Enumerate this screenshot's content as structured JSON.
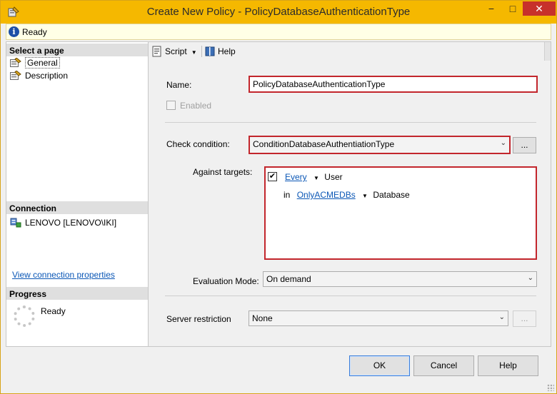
{
  "window": {
    "title": "Create New Policy - PolicyDatabaseAuthenticationType",
    "minimize_glyph": "−",
    "maximize_glyph": "□",
    "close_glyph": "✕"
  },
  "status": {
    "icon": "info-icon",
    "glyph": "i",
    "text": "Ready"
  },
  "left_pane": {
    "select_page_header": "Select a page",
    "pages": [
      {
        "label": "General",
        "icon": "page-settings-icon"
      },
      {
        "label": "Description",
        "icon": "page-settings-icon"
      }
    ],
    "connection_header": "Connection",
    "connection_text": "LENOVO [LENOVO\\IKI]",
    "connection_icon": "server-connection-icon",
    "view_connection_link": "View connection properties",
    "progress_header": "Progress",
    "progress_text": "Ready",
    "progress_icon": "progress-spinner-icon"
  },
  "toolbar": {
    "script_label": "Script",
    "script_caret": "▼",
    "help_label": "Help"
  },
  "form": {
    "name_label": "Name:",
    "name_value": "PolicyDatabaseAuthenticationType",
    "enabled_label": "Enabled",
    "enabled_checked": false,
    "check_condition_label": "Check condition:",
    "check_condition_value": "ConditionDatabaseAuthentiationType",
    "ellipsis_label": "...",
    "against_targets_label": "Against targets:",
    "targets": {
      "row1_checked": true,
      "row1_check_glyph": "✔",
      "row1_link": "Every",
      "row1_caret": "▼",
      "row1_text": "User",
      "row2_prefix": "in",
      "row2_link": "OnlyACMEDBs",
      "row2_caret": "▼",
      "row2_text": "Database"
    },
    "evaluation_mode_label": "Evaluation Mode:",
    "evaluation_mode_value": "On demand",
    "server_restriction_label": "Server restriction",
    "server_restriction_value": "None",
    "server_ellipsis_label": "...",
    "dropdown_arrow": "⌄"
  },
  "buttons": {
    "ok": "OK",
    "cancel": "Cancel",
    "help": "Help"
  },
  "colors": {
    "title_bar": "#f5b800",
    "close_button": "#c7312b",
    "highlight_border": "#c2262c",
    "link": "#0b57b6"
  }
}
